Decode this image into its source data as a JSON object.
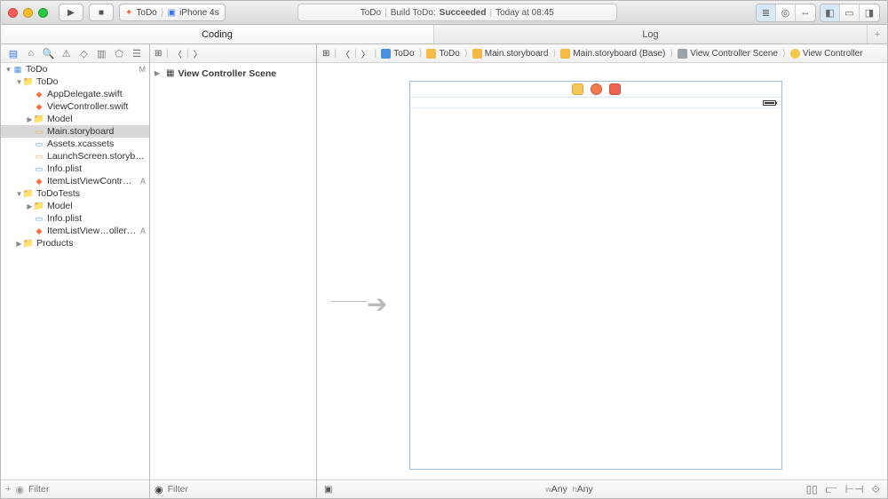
{
  "toolbar": {
    "scheme_project": "ToDo",
    "scheme_device": "iPhone 4s",
    "status_project": "ToDo",
    "status_action": "Build ToDo:",
    "status_result": "Succeeded",
    "status_time": "Today at 08:45"
  },
  "tabs": {
    "left": "Coding",
    "right": "Log"
  },
  "nav": {
    "tree": [
      {
        "depth": 0,
        "disclosure": "▼",
        "icon": "proj",
        "label": "ToDo",
        "badge": "M"
      },
      {
        "depth": 1,
        "disclosure": "▼",
        "icon": "folder",
        "label": "ToDo"
      },
      {
        "depth": 2,
        "disclosure": "",
        "icon": "swift",
        "label": "AppDelegate.swift"
      },
      {
        "depth": 2,
        "disclosure": "",
        "icon": "swift",
        "label": "ViewController.swift"
      },
      {
        "depth": 2,
        "disclosure": "▶",
        "icon": "folder",
        "label": "Model"
      },
      {
        "depth": 2,
        "disclosure": "",
        "icon": "yellow",
        "label": "Main.storyboard",
        "selected": true
      },
      {
        "depth": 2,
        "disclosure": "",
        "icon": "blue",
        "label": "Assets.xcassets"
      },
      {
        "depth": 2,
        "disclosure": "",
        "icon": "yellow",
        "label": "LaunchScreen.storyboard"
      },
      {
        "depth": 2,
        "disclosure": "",
        "icon": "blue",
        "label": "Info.plist"
      },
      {
        "depth": 2,
        "disclosure": "",
        "icon": "swift",
        "label": "ItemListViewController.swift",
        "badge": "A"
      },
      {
        "depth": 1,
        "disclosure": "▼",
        "icon": "folder",
        "label": "ToDoTests"
      },
      {
        "depth": 2,
        "disclosure": "▶",
        "icon": "folder",
        "label": "Model"
      },
      {
        "depth": 2,
        "disclosure": "",
        "icon": "blue",
        "label": "Info.plist"
      },
      {
        "depth": 2,
        "disclosure": "",
        "icon": "swift",
        "label": "ItemListView…ollerTests.swift",
        "badge": "A"
      },
      {
        "depth": 1,
        "disclosure": "▶",
        "icon": "folder",
        "label": "Products"
      }
    ],
    "filter_placeholder": "Filter"
  },
  "outline": {
    "header": "View Controller Scene",
    "filter_placeholder": "Filter"
  },
  "jumpbar": {
    "items": [
      {
        "icon": "blue",
        "text": "ToDo"
      },
      {
        "icon": "yellow",
        "text": "ToDo"
      },
      {
        "icon": "yellow",
        "text": "Main.storyboard"
      },
      {
        "icon": "yellow",
        "text": "Main.storyboard (Base)"
      },
      {
        "icon": "grey",
        "text": "View Controller Scene"
      },
      {
        "icon": "gold",
        "text": "View Controller"
      }
    ]
  },
  "sizeclass": {
    "w_prefix": "w",
    "w": "Any",
    "h_prefix": "h",
    "h": "Any"
  }
}
